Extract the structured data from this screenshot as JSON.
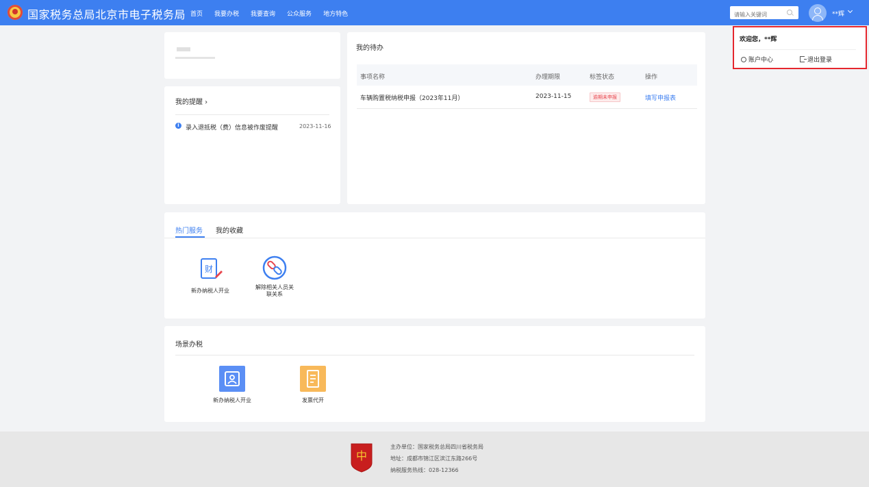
{
  "header": {
    "site_title": "国家税务总局北京市电子税务局",
    "nav": [
      "首页",
      "我要办税",
      "我要查询",
      "公众服务",
      "地方特色"
    ],
    "search_placeholder": "请输入关键词",
    "user_name": "**辉"
  },
  "user_menu": {
    "welcome": "欢迎您，**辉",
    "account_center": "账户中心",
    "logout": "退出登录"
  },
  "reminders": {
    "title": "我的提醒 ›",
    "items": [
      {
        "text": "录入退抵税（费）信息被作废提醒",
        "date": "2023-11-16"
      }
    ]
  },
  "todo": {
    "title": "我的待办",
    "columns": [
      "事项名称",
      "办理期限",
      "标签状态",
      "操作"
    ],
    "rows": [
      {
        "name": "车辆购置税纳税申报（2023年11月）",
        "deadline": "2023-11-15",
        "status": "逾期未申报",
        "action": "填写申报表"
      }
    ]
  },
  "services": {
    "tabs": [
      "热门服务",
      "我的收藏"
    ],
    "items": [
      {
        "label": "新办纳税人开业",
        "icon": "finance-form-icon"
      },
      {
        "label": "解除相关人员关联关系",
        "label_line1": "解除相关人员关",
        "label_line2": "联关系",
        "icon": "unlink-icon"
      }
    ]
  },
  "scenes": {
    "title": "场景办税",
    "items": [
      {
        "label": "新办纳税人开业",
        "icon": "registration-icon"
      },
      {
        "label": "发票代开",
        "icon": "invoice-icon"
      }
    ]
  },
  "footer": {
    "host": "主办单位：国家税务总局四川省税务局",
    "address": "地址：成都市锦江区滨江东路266号",
    "hotline": "纳税服务热线：028-12366",
    "emblem_text": "党政机关"
  },
  "colors": {
    "primary": "#3d7ff0",
    "danger": "#e5262d",
    "overdue": "#e8464e"
  }
}
